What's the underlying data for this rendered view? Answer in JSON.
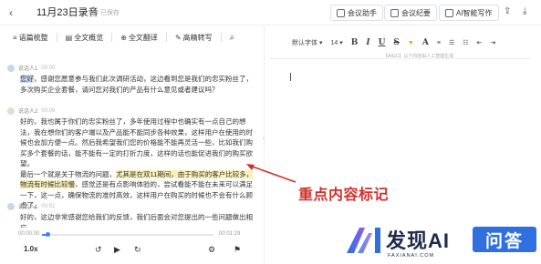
{
  "header": {
    "back_icon": "‹",
    "title": "11月23日录音",
    "save_note": "已保存",
    "buttons": [
      {
        "label": "会议助手"
      },
      {
        "label": "会议纪要"
      },
      {
        "label": "AI智能写作"
      }
    ],
    "share_icon": "⇪",
    "download_icon": "⤓"
  },
  "left_toolbar": {
    "items": [
      {
        "label": "语篇梳整",
        "icon": "≡"
      },
      {
        "label": "全文概览",
        "icon": "▤"
      },
      {
        "label": "全文翻译",
        "icon": "⊕"
      },
      {
        "label": "高精转写",
        "icon": "✎"
      }
    ],
    "search_icon": "⌕"
  },
  "transcript": {
    "segments": [
      {
        "speaker": "说话人1",
        "time": "00:00",
        "text_pre": "",
        "text_hl_blue": "您好",
        "text_post": "，感谢您愿意参与我们此次调研活动，这边看到您是我们的忠实粉丝了，多次购买企业套餐，请问您对我们的产品有什么意见或者建议吗？"
      },
      {
        "speaker": "说话人2",
        "time": "00:09",
        "text_pre": "好的，我也属于你们的忠实粉丝了，多年使用过程中也确实有一点自己的想法，我在想你们的客户端以及产品能不能同步各种效果，这样用户在使用的时候也会加方便一点。然后我希望我们您的价格能不能再灵活一些，比如我们购买多个套餐的话，能不能有一定的打折力度，这样的话也能促进我们的购买欲望。\n最后一个就是关于物流的问题，",
        "text_hl_yellow": "尤其是在双11期间，由于购买的客户比较多，物流有时候比较慢",
        "text_post": "，感觉还是有点影响体验的，尝试看能不能在未来可以满足一下，这一点，确保物流的准时高效，这样用户在购买的时候也不会有什么顾虑了。"
      },
      {
        "speaker": "说话人1",
        "time": "00:51",
        "text_pre": "好的，这边非常感谢您给我们的反馈，我们后面会对您提出的一些问题做出相应",
        "text_hl_blue": "",
        "text_post": ""
      }
    ]
  },
  "editor": {
    "font_family": "默认字体",
    "font_size": "14",
    "tools": [
      "B",
      "I",
      "U",
      "S",
      "A",
      "≡",
      "☰",
      "☷",
      "⇤",
      "⇥"
    ],
    "note": "【AIGC】以下内容由人工智能生成",
    "collapse_icon": "‹"
  },
  "annotation": {
    "label": "重点内容标记"
  },
  "player": {
    "current": "00:00:00",
    "total": "00:01:29",
    "speed": "1.0x",
    "progress": 0.03,
    "rewind_icon": "↺",
    "play_icon": "▶",
    "forward_icon": "↻",
    "settings_icon": "⚙",
    "flag_icon": "⚑"
  },
  "watermark": {
    "brand": "发现AI",
    "domain": "FAXIANAI.COM",
    "badge": "问答"
  }
}
